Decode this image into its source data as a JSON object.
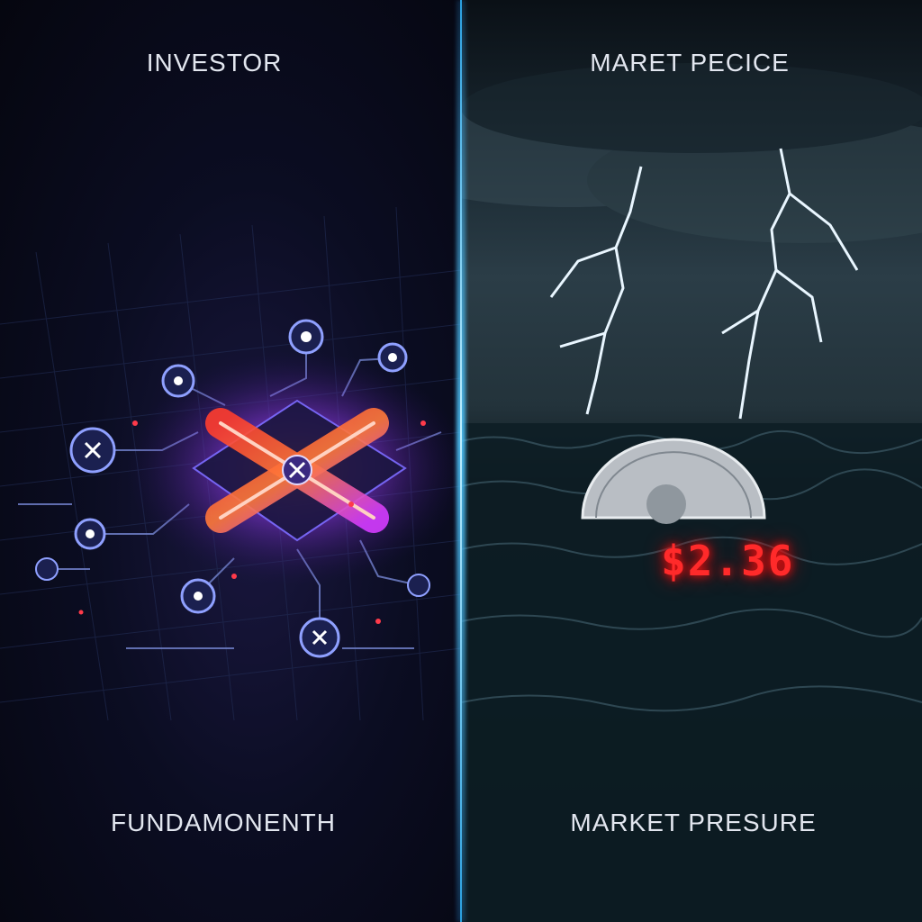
{
  "panels": {
    "left": {
      "top_caption": "INVESTOR",
      "bottom_caption": "FUNDAMONENTH"
    },
    "right": {
      "top_caption": "MARET PECICE",
      "bottom_caption": "MARKET PRESURE",
      "price_display": "$2.36"
    }
  },
  "colors": {
    "accent_red": "#ff2a2a",
    "circuit_blue": "#4a6cff",
    "divider_glow": "#7fd8ff"
  },
  "icons": [
    "circuit-node-icon",
    "x-logo-icon",
    "lightning-bolt-icon",
    "coin-icon"
  ]
}
